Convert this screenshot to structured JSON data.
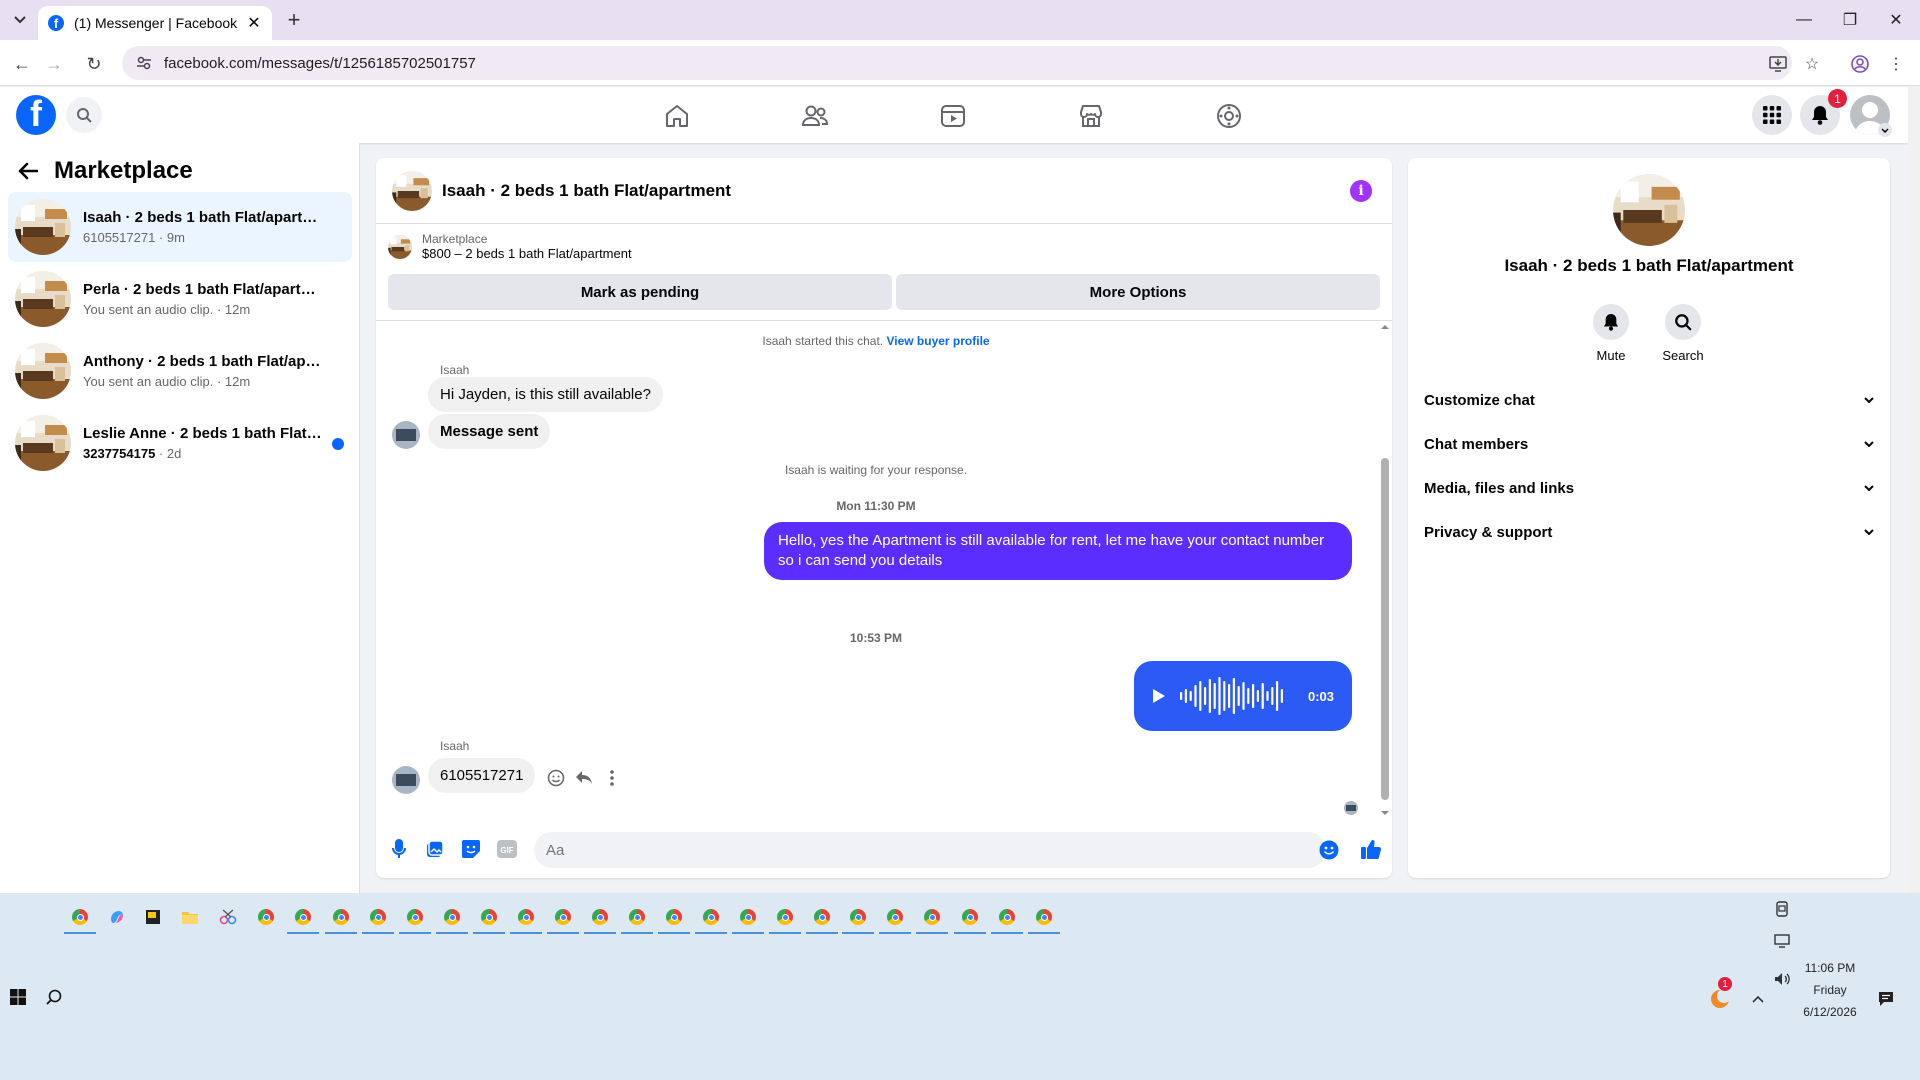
{
  "browser": {
    "tab_title": "(1) Messenger | Facebook",
    "url": "facebook.com/messages/t/1256185702501757"
  },
  "header": {
    "notification_count": "1"
  },
  "sidebar": {
    "title": "Marketplace",
    "conversations": [
      {
        "name": "Isaah · 2 beds 1 bath Flat/apartment",
        "sub": "6105517271 · 9m",
        "active": true,
        "unread": false
      },
      {
        "name": "Perla · 2 beds 1 bath Flat/apartment",
        "sub": "You sent an audio clip. · 12m",
        "active": false,
        "unread": false
      },
      {
        "name": "Anthony · 2 beds 1 bath Flat/apart...",
        "sub": "You sent an audio clip. · 12m",
        "active": false,
        "unread": false
      },
      {
        "name": "Leslie Anne · 2 beds 1 bath Flat/a...",
        "sub_main": "3237754175",
        "sub_time": " · 2d",
        "active": false,
        "unread": true
      }
    ]
  },
  "chat": {
    "title": "Isaah · 2 beds 1 bath Flat/apartment",
    "marketplace_label": "Marketplace",
    "listing": "$800 – 2 beds 1 bath Flat/apartment",
    "mark_pending_label": "Mark as pending",
    "more_options_label": "More Options",
    "started_text": "Isaah started this chat.",
    "view_buyer_profile": "View buyer profile",
    "sender_name": "Isaah",
    "msg_in_1": "Hi Jayden, is this still available?",
    "msg_in_2": "Message sent",
    "waiting_text": "Isaah is waiting for your response.",
    "timestamp_1": "Mon 11:30 PM",
    "msg_out_1": "Hello, yes the Apartment is still available for rent, let me have your contact number so i can send you details",
    "timestamp_2": "10:53 PM",
    "audio_duration": "0:03",
    "sender_name_2": "Isaah",
    "msg_in_3": "6105517271",
    "compose_placeholder": "Aa"
  },
  "info_panel": {
    "name": "Isaah · 2 beds 1 bath Flat/apartment",
    "mute_label": "Mute",
    "search_label": "Search",
    "sections": [
      "Customize chat",
      "Chat members",
      "Media, files and links",
      "Privacy & support"
    ]
  },
  "taskbar": {
    "time": "11:06 PM",
    "day": "Friday",
    "date": "6/12/2026",
    "tray_badge": "1"
  },
  "colors": {
    "accent": "#0866ff",
    "outgoing_bubble": "#5b2eff",
    "audio_bubble": "#2c5af5",
    "info_icon": "#a033ff"
  }
}
